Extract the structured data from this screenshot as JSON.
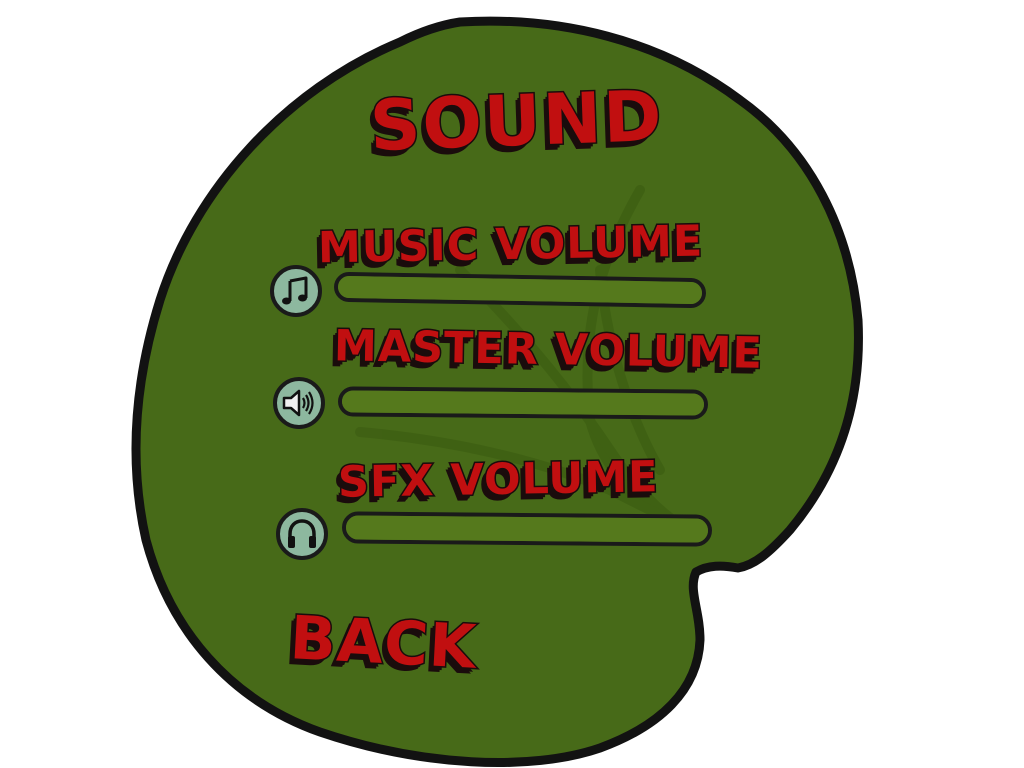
{
  "menu": {
    "title": "SOUND",
    "back_label": "BACK"
  },
  "settings": [
    {
      "id": "music",
      "label": "MUSIC VOLUME",
      "icon": "music-note-icon",
      "level_percent": 100
    },
    {
      "id": "master",
      "label": "MASTER VOLUME",
      "icon": "speaker-icon",
      "level_percent": 100
    },
    {
      "id": "sfx",
      "label": "SFX VOLUME",
      "icon": "headphones-icon",
      "level_percent": 100
    }
  ],
  "colors": {
    "lily_pad": "#476a18",
    "outline": "#1a1a1a",
    "text_red": "#c10f10",
    "icon_bg": "#8db89f"
  }
}
